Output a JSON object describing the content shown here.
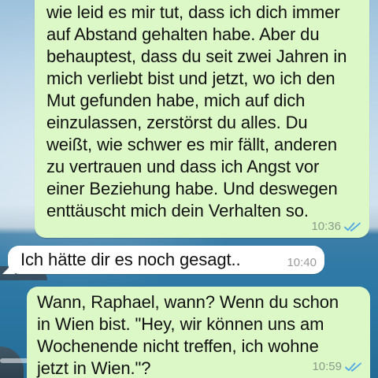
{
  "colors": {
    "outgoing_bubble": "#dcf8c6",
    "incoming_bubble": "#ffffff",
    "read_ticks": "#4fa6e6"
  },
  "messages": [
    {
      "direction": "outgoing",
      "text": "wie leid es mir tut, dass ich dich immer\nauf Abstand gehalten habe. Aber du\nbehauptest, dass du seit zwei Jahren in\nmich verliebt bist und jetzt, wo ich den\nMut gefunden habe, mich auf dich\neinzulassen, zerstörst du alles. Du\nweißt, wie schwer es mir fällt, anderen\nzu vertrauen und dass ich Angst vor\neiner Beziehung habe. Und deswegen\nenttäuscht mich dein Verhalten so.",
      "time": "10:36",
      "status_icon": "double-check-read-icon"
    },
    {
      "direction": "incoming",
      "text": "Ich hätte dir es noch gesagt..",
      "time": "10:40"
    },
    {
      "direction": "outgoing",
      "text": "Wann, Raphael, wann? Wenn du schon\nin Wien bist. \"Hey, wir können uns am\nWochenende nicht treffen, ich wohne\njetzt in Wien.\"?",
      "time": "10:59",
      "status_icon": "double-check-read-icon"
    }
  ]
}
